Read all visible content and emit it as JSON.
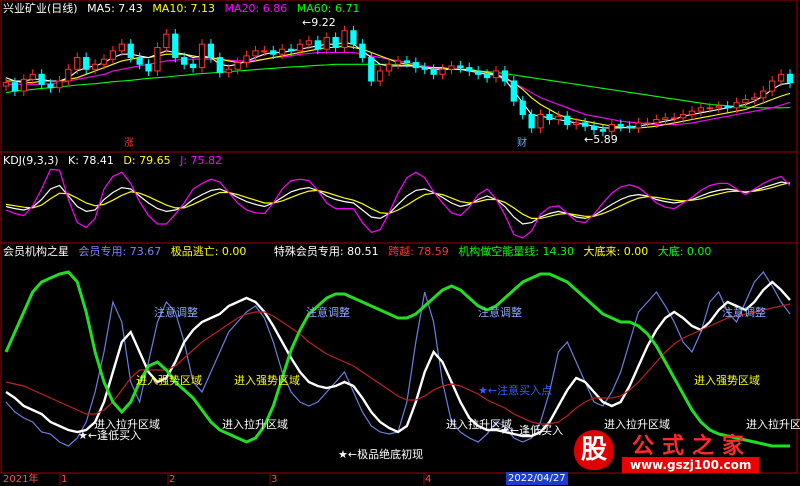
{
  "panels": {
    "price": {
      "title": "兴业矿业(日线)",
      "ma": [
        {
          "label": "MA5: 7.43",
          "color": "#ffffff"
        },
        {
          "label": "MA10: 7.13",
          "color": "#ffff00"
        },
        {
          "label": "MA20: 6.86",
          "color": "#ff00ff"
        },
        {
          "label": "MA60: 6.71",
          "color": "#00ff00"
        }
      ],
      "high_label": "9.22",
      "low_label": "5.89",
      "marker_zhang": "涨",
      "marker_cai": "财"
    },
    "kdj": {
      "title": "KDJ(9,3,3)",
      "values": [
        {
          "label": "K: 78.41",
          "color": "#ffffff"
        },
        {
          "label": "D: 79.65",
          "color": "#ffff00"
        },
        {
          "label": "J: 75.82",
          "color": "#ff00ff"
        }
      ]
    },
    "member": {
      "title": "会员机构之星",
      "values": [
        {
          "label": "会员专用: 73.67",
          "color": "#8080ff"
        },
        {
          "label": "极品逃亡: 0.00",
          "color": "#ffff00"
        },
        {
          "label": "特殊会员专用: 80.51",
          "color": "#ffffff"
        },
        {
          "label": "跨越: 78.59",
          "color": "#ff3030"
        },
        {
          "label": "机构做空能量线: 14.30",
          "color": "#00ff00"
        },
        {
          "label": "大底来: 0.00",
          "color": "#ffff00"
        },
        {
          "label": "大底: 0.00",
          "color": "#00ff00"
        }
      ],
      "annotations": {
        "attention": "注意调整",
        "strong": "进入强势区域",
        "pull": "进入拉升区域",
        "low_buy": "←逢低买入",
        "stock_buy": "←注意买入点",
        "bottom": "←极品绝底初现"
      }
    }
  },
  "x_axis": {
    "labels": [
      "2021年",
      "1",
      "2",
      "3",
      "4",
      "2022/04/27"
    ]
  },
  "watermark": {
    "glyph": "股",
    "name": "公式之家",
    "url": "www.gszj100.com"
  },
  "chart_data": [
    {
      "type": "candlestick",
      "title": "兴业矿业(日线)",
      "ylim": [
        5.5,
        9.5
      ],
      "high": 9.22,
      "low": 5.89,
      "close": [
        7.45,
        7.2,
        7.55,
        7.7,
        7.4,
        7.3,
        7.5,
        7.85,
        8.2,
        7.85,
        8.0,
        8.15,
        8.4,
        8.6,
        8.2,
        8.0,
        7.8,
        8.5,
        8.9,
        8.2,
        8.0,
        7.9,
        8.6,
        8.2,
        7.75,
        7.85,
        8.05,
        8.25,
        8.4,
        8.4,
        8.3,
        8.45,
        8.4,
        8.6,
        8.7,
        8.45,
        8.8,
        8.5,
        9.0,
        8.6,
        8.2,
        7.5,
        7.8,
        8.0,
        8.1,
        8.05,
        7.9,
        7.85,
        7.7,
        7.85,
        7.95,
        7.9,
        7.8,
        7.7,
        7.6,
        7.8,
        7.5,
        6.9,
        6.5,
        6.1,
        6.5,
        6.35,
        6.45,
        6.2,
        6.25,
        6.15,
        6.05,
        6.0,
        6.2,
        6.15,
        6.1,
        6.25,
        6.25,
        6.35,
        6.4,
        6.4,
        6.5,
        6.6,
        6.7,
        6.7,
        6.75,
        6.7,
        6.85,
        6.95,
        7.0,
        7.2,
        7.5,
        7.7,
        7.45
      ],
      "ma5": [
        7.6,
        7.5,
        7.5,
        7.55,
        7.55,
        7.5,
        7.5,
        7.6,
        7.8,
        7.9,
        7.95,
        8.05,
        8.2,
        8.3,
        8.3,
        8.25,
        8.2,
        8.3,
        8.4,
        8.35,
        8.3,
        8.2,
        8.25,
        8.2,
        8.0,
        7.95,
        8.0,
        8.1,
        8.2,
        8.3,
        8.35,
        8.35,
        8.4,
        8.45,
        8.5,
        8.55,
        8.6,
        8.6,
        8.65,
        8.6,
        8.4,
        8.2,
        8.0,
        7.95,
        7.95,
        7.95,
        7.95,
        7.9,
        7.85,
        7.85,
        7.85,
        7.85,
        7.8,
        7.75,
        7.7,
        7.7,
        7.55,
        7.2,
        6.85,
        6.5,
        6.45,
        6.4,
        6.35,
        6.3,
        6.25,
        6.2,
        6.15,
        6.1,
        6.1,
        6.1,
        6.12,
        6.15,
        6.2,
        6.25,
        6.3,
        6.35,
        6.45,
        6.5,
        6.55,
        6.6,
        6.65,
        6.7,
        6.75,
        6.8,
        6.9,
        7.05,
        7.25,
        7.4,
        7.43
      ],
      "ma10": [
        7.5,
        7.5,
        7.45,
        7.45,
        7.5,
        7.5,
        7.5,
        7.55,
        7.6,
        7.7,
        7.8,
        7.9,
        8.0,
        8.1,
        8.15,
        8.2,
        8.2,
        8.25,
        8.3,
        8.3,
        8.3,
        8.25,
        8.2,
        8.2,
        8.15,
        8.1,
        8.05,
        8.05,
        8.1,
        8.15,
        8.2,
        8.25,
        8.3,
        8.35,
        8.4,
        8.45,
        8.5,
        8.5,
        8.55,
        8.5,
        8.45,
        8.35,
        8.25,
        8.15,
        8.05,
        8.0,
        7.95,
        7.9,
        7.9,
        7.9,
        7.85,
        7.85,
        7.85,
        7.8,
        7.75,
        7.7,
        7.6,
        7.45,
        7.25,
        7.0,
        6.8,
        6.65,
        6.5,
        6.4,
        6.35,
        6.3,
        6.25,
        6.2,
        6.15,
        6.12,
        6.1,
        6.1,
        6.12,
        6.15,
        6.2,
        6.25,
        6.3,
        6.35,
        6.4,
        6.45,
        6.5,
        6.55,
        6.6,
        6.65,
        6.75,
        6.85,
        6.95,
        7.05,
        7.13
      ],
      "ma20": [
        7.4,
        7.4,
        7.4,
        7.4,
        7.4,
        7.42,
        7.45,
        7.5,
        7.55,
        7.6,
        7.65,
        7.7,
        7.8,
        7.85,
        7.9,
        7.95,
        8.0,
        8.05,
        8.1,
        8.12,
        8.15,
        8.15,
        8.15,
        8.15,
        8.15,
        8.12,
        8.1,
        8.1,
        8.12,
        8.15,
        8.2,
        8.22,
        8.25,
        8.3,
        8.32,
        8.35,
        8.35,
        8.35,
        8.35,
        8.35,
        8.3,
        8.25,
        8.2,
        8.15,
        8.1,
        8.05,
        8.0,
        7.95,
        7.9,
        7.85,
        7.85,
        7.85,
        7.8,
        7.75,
        7.7,
        7.65,
        7.55,
        7.45,
        7.3,
        7.15,
        7.0,
        6.9,
        6.8,
        6.7,
        6.6,
        6.5,
        6.45,
        6.4,
        6.35,
        6.3,
        6.27,
        6.25,
        6.22,
        6.2,
        6.2,
        6.2,
        6.22,
        6.25,
        6.3,
        6.35,
        6.4,
        6.45,
        6.5,
        6.55,
        6.6,
        6.65,
        6.7,
        6.78,
        6.86
      ],
      "ma60": [
        7.15,
        7.2,
        7.22,
        7.25,
        7.28,
        7.3,
        7.32,
        7.35,
        7.38,
        7.4,
        7.42,
        7.45,
        7.48,
        7.5,
        7.52,
        7.55,
        7.58,
        7.6,
        7.62,
        7.65,
        7.67,
        7.7,
        7.72,
        7.74,
        7.76,
        7.78,
        7.8,
        7.82,
        7.84,
        7.86,
        7.88,
        7.9,
        7.92,
        7.93,
        7.95,
        7.97,
        7.98,
        8.0,
        8.0,
        8.0,
        8.0,
        8.0,
        8.0,
        8.0,
        7.98,
        7.96,
        7.94,
        7.92,
        7.9,
        7.88,
        7.86,
        7.84,
        7.82,
        7.8,
        7.78,
        7.75,
        7.72,
        7.68,
        7.64,
        7.6,
        7.56,
        7.52,
        7.48,
        7.44,
        7.4,
        7.36,
        7.32,
        7.28,
        7.24,
        7.2,
        7.16,
        7.12,
        7.08,
        7.04,
        7.0,
        6.96,
        6.92,
        6.88,
        6.84,
        6.8,
        6.78,
        6.76,
        6.74,
        6.72,
        6.71,
        6.7,
        6.7,
        6.7,
        6.71
      ]
    },
    {
      "type": "line",
      "title": "KDJ(9,3,3)",
      "ylim": [
        0,
        100
      ],
      "series": [
        {
          "name": "K",
          "color": "#ffffff",
          "values": [
            45,
            42,
            40,
            44,
            55,
            70,
            75,
            60,
            45,
            38,
            40,
            55,
            65,
            72,
            70,
            60,
            50,
            42,
            38,
            40,
            45,
            55,
            62,
            68,
            70,
            65,
            58,
            52,
            48,
            45,
            50,
            58,
            66,
            70,
            72,
            68,
            60,
            55,
            52,
            50,
            40,
            30,
            28,
            35,
            48,
            60,
            68,
            70,
            65,
            58,
            50,
            45,
            48,
            55,
            60,
            55,
            45,
            30,
            20,
            22,
            30,
            35,
            38,
            35,
            30,
            28,
            32,
            40,
            48,
            55,
            60,
            62,
            60,
            55,
            52,
            50,
            52,
            55,
            60,
            65,
            68,
            70,
            68,
            65,
            68,
            72,
            76,
            80,
            78
          ]
        },
        {
          "name": "D",
          "color": "#ffff00",
          "values": [
            48,
            46,
            44,
            43,
            47,
            56,
            64,
            63,
            57,
            50,
            46,
            48,
            54,
            61,
            66,
            64,
            59,
            53,
            47,
            43,
            43,
            48,
            54,
            60,
            65,
            65,
            62,
            58,
            54,
            50,
            50,
            53,
            58,
            63,
            67,
            68,
            65,
            61,
            57,
            54,
            49,
            42,
            36,
            35,
            40,
            47,
            55,
            62,
            64,
            62,
            57,
            52,
            50,
            52,
            55,
            55,
            51,
            43,
            34,
            28,
            28,
            31,
            34,
            35,
            33,
            31,
            31,
            35,
            40,
            46,
            52,
            57,
            59,
            58,
            56,
            54,
            53,
            54,
            56,
            60,
            63,
            66,
            67,
            66,
            67,
            69,
            72,
            76,
            79
          ]
        },
        {
          "name": "J",
          "color": "#ff00ff",
          "values": [
            40,
            35,
            32,
            46,
            70,
            98,
            97,
            55,
            22,
            15,
            28,
            70,
            88,
            94,
            78,
            52,
            32,
            20,
            20,
            34,
            50,
            70,
            78,
            84,
            80,
            65,
            50,
            40,
            36,
            35,
            50,
            70,
            82,
            84,
            82,
            68,
            50,
            42,
            42,
            42,
            22,
            8,
            12,
            36,
            64,
            86,
            94,
            86,
            66,
            50,
            36,
            32,
            44,
            62,
            70,
            56,
            33,
            5,
            0,
            10,
            34,
            44,
            46,
            35,
            24,
            22,
            34,
            50,
            64,
            73,
            76,
            72,
            62,
            50,
            44,
            42,
            50,
            58,
            68,
            75,
            78,
            78,
            70,
            62,
            70,
            78,
            84,
            88,
            75
          ]
        }
      ]
    },
    {
      "type": "line",
      "title": "会员机构之星",
      "ylim": [
        0,
        100
      ],
      "series": [
        {
          "name": "会员专用",
          "color": "#6a7fe0",
          "values": [
            30,
            25,
            22,
            20,
            15,
            14,
            10,
            8,
            12,
            20,
            35,
            55,
            80,
            70,
            40,
            30,
            50,
            70,
            80,
            75,
            60,
            40,
            35,
            45,
            55,
            65,
            70,
            75,
            78,
            72,
            60,
            45,
            35,
            30,
            28,
            30,
            35,
            40,
            45,
            35,
            25,
            18,
            15,
            14,
            15,
            30,
            60,
            85,
            70,
            40,
            20,
            15,
            12,
            10,
            14,
            20,
            18,
            12,
            10,
            12,
            20,
            35,
            55,
            60,
            50,
            40,
            30,
            28,
            35,
            45,
            60,
            75,
            80,
            85,
            78,
            70,
            60,
            55,
            65,
            80,
            85,
            75,
            70,
            80,
            90,
            95,
            88,
            80,
            74
          ]
        },
        {
          "name": "特殊会员专用",
          "color": "#ffffff",
          "values": [
            35,
            32,
            28,
            26,
            24,
            20,
            18,
            16,
            15,
            16,
            20,
            30,
            45,
            60,
            65,
            55,
            45,
            40,
            42,
            50,
            60,
            66,
            70,
            72,
            74,
            78,
            80,
            82,
            80,
            75,
            68,
            60,
            52,
            45,
            40,
            38,
            37,
            38,
            40,
            38,
            32,
            25,
            20,
            17,
            15,
            18,
            30,
            45,
            55,
            50,
            40,
            30,
            22,
            18,
            16,
            16,
            15,
            14,
            13,
            13,
            15,
            20,
            28,
            36,
            42,
            40,
            35,
            30,
            28,
            30,
            38,
            48,
            58,
            66,
            72,
            75,
            72,
            68,
            66,
            70,
            76,
            80,
            78,
            76,
            80,
            86,
            90,
            86,
            81
          ]
        },
        {
          "name": "跨越",
          "color": "#c02020",
          "values": [
            40,
            39,
            38,
            36,
            34,
            32,
            30,
            28,
            26,
            24,
            24,
            26,
            30,
            36,
            42,
            46,
            46,
            46,
            46,
            48,
            52,
            56,
            60,
            63,
            66,
            69,
            72,
            74,
            75,
            75,
            73,
            70,
            67,
            64,
            60,
            57,
            54,
            52,
            50,
            48,
            45,
            42,
            39,
            36,
            33,
            31,
            31,
            33,
            36,
            38,
            39,
            38,
            36,
            34,
            31,
            29,
            27,
            24,
            22,
            20,
            19,
            19,
            20,
            23,
            27,
            30,
            32,
            32,
            32,
            33,
            36,
            40,
            45,
            50,
            55,
            59,
            62,
            64,
            66,
            68,
            70,
            72,
            73,
            74,
            75,
            76,
            77,
            78,
            79
          ]
        },
        {
          "name": "机构做空能量线",
          "color": "#22dd22",
          "values": [
            55,
            65,
            75,
            85,
            90,
            92,
            94,
            95,
            90,
            75,
            55,
            40,
            30,
            25,
            30,
            40,
            48,
            50,
            46,
            40,
            36,
            32,
            26,
            20,
            16,
            14,
            12,
            10,
            12,
            18,
            28,
            42,
            56,
            66,
            74,
            78,
            82,
            84,
            84,
            82,
            80,
            78,
            76,
            74,
            72,
            72,
            74,
            78,
            82,
            86,
            88,
            86,
            82,
            78,
            76,
            78,
            82,
            86,
            90,
            92,
            94,
            94,
            92,
            90,
            86,
            82,
            78,
            74,
            72,
            70,
            70,
            68,
            64,
            58,
            50,
            42,
            34,
            26,
            20,
            16,
            14,
            13,
            12,
            11,
            10,
            9,
            8,
            8,
            8
          ]
        }
      ]
    }
  ]
}
